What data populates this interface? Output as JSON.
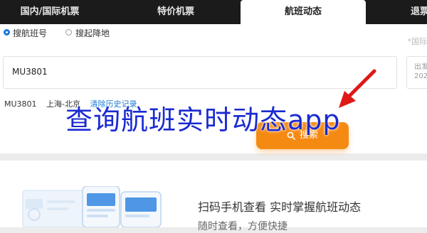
{
  "tabs": [
    {
      "label": "国内/国际机票"
    },
    {
      "label": "特价机票"
    },
    {
      "label": "航班动态"
    },
    {
      "label": "退票"
    }
  ],
  "search_mode": {
    "option_flight_no": "搜航班号",
    "option_route": "搜起降地",
    "selected": "搜航班号",
    "hint": "*国际"
  },
  "flight_input": {
    "value": "MU3801"
  },
  "date_field": {
    "label": "出发",
    "value": "202"
  },
  "history": {
    "flight": "MU3801",
    "route": "上海-北京",
    "link": "清除历史记录"
  },
  "search_button": {
    "label": "搜索",
    "icon": "search-icon"
  },
  "overlay_title": "查询航班实时动态app",
  "promo": {
    "heading": "扫码手机查看  实时掌握航班动态",
    "subheading": "随时查看，方便快捷"
  },
  "colors": {
    "tab_bar": "#1b1b1b",
    "accent_blue": "#1b78d6",
    "search_orange": "#f58a13",
    "overlay_text": "#1a2ad1",
    "arrow_red": "#e01818"
  }
}
